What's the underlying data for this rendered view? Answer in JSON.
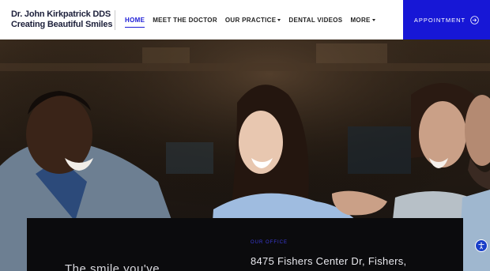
{
  "brand": {
    "line1": "Dr. John Kirkpatrick DDS",
    "line2": "Creating Beautiful Smiles"
  },
  "nav": {
    "items": [
      {
        "label": "HOME",
        "active": true,
        "dropdown": false
      },
      {
        "label": "MEET THE DOCTOR",
        "active": false,
        "dropdown": false
      },
      {
        "label": "OUR PRACTICE",
        "active": false,
        "dropdown": true
      },
      {
        "label": "DENTAL VIDEOS",
        "active": false,
        "dropdown": false
      },
      {
        "label": "MORE",
        "active": false,
        "dropdown": true
      }
    ]
  },
  "appointment": {
    "label": "APPOINTMENT",
    "icon": "arrow-circle-right-icon"
  },
  "hero": {
    "image": "people-smiling-photo"
  },
  "office": {
    "label": "OUR OFFICE",
    "address": "8475 Fishers Center Dr, Fishers,"
  },
  "tagline": {
    "partial": "The smile you've"
  },
  "accessibility": {
    "icon": "accessibility-icon"
  },
  "colors": {
    "accent": "#1717d6",
    "brand_text": "#1c1f3a",
    "card_bg": "#0b0b0d"
  }
}
